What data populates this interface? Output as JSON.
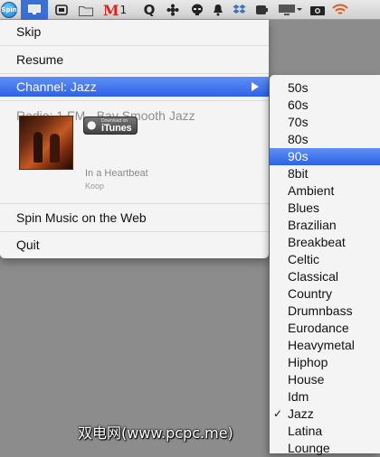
{
  "menubar": {
    "spin_icon_label": "Spin",
    "gmail_letter": "M",
    "gmail_count": "1",
    "icons": [
      "spin-icon",
      "monitor-icon",
      "terminal-icon",
      "folder-icon",
      "gmail-icon",
      "quicksilver-icon",
      "flower-icon",
      "alien-icon",
      "bell-icon",
      "dropbox-icon",
      "battery-icon",
      "display-icon",
      "camera-icon",
      "wifi-icon"
    ],
    "colors": {
      "highlight": "#3b6fd6",
      "wifi": "#e05a1c",
      "gmail": "#d5281c"
    }
  },
  "menu": {
    "skip": "Skip",
    "resume": "Resume",
    "channel": "Channel: Jazz",
    "radio": "Radio: 1.FM - Bay Smooth Jazz",
    "itunes_small": "Download on",
    "itunes_big": "iTunes",
    "song": "In a Heartbeat",
    "artist": "Koop",
    "spin_web": "Spin Music on the Web",
    "quit": "Quit"
  },
  "channels": {
    "items": [
      "50s",
      "60s",
      "70s",
      "80s",
      "90s",
      "8bit",
      "Ambient",
      "Blues",
      "Brazilian",
      "Breakbeat",
      "Celtic",
      "Classical",
      "Country",
      "Drumnbass",
      "Eurodance",
      "Heavymetal",
      "Hiphop",
      "House",
      "Idm",
      "Jazz",
      "Latina",
      "Lounge"
    ],
    "highlighted": "90s",
    "checked": "Jazz",
    "check_mark": "✓"
  },
  "watermark": "双电网(www.pcpc.me)"
}
